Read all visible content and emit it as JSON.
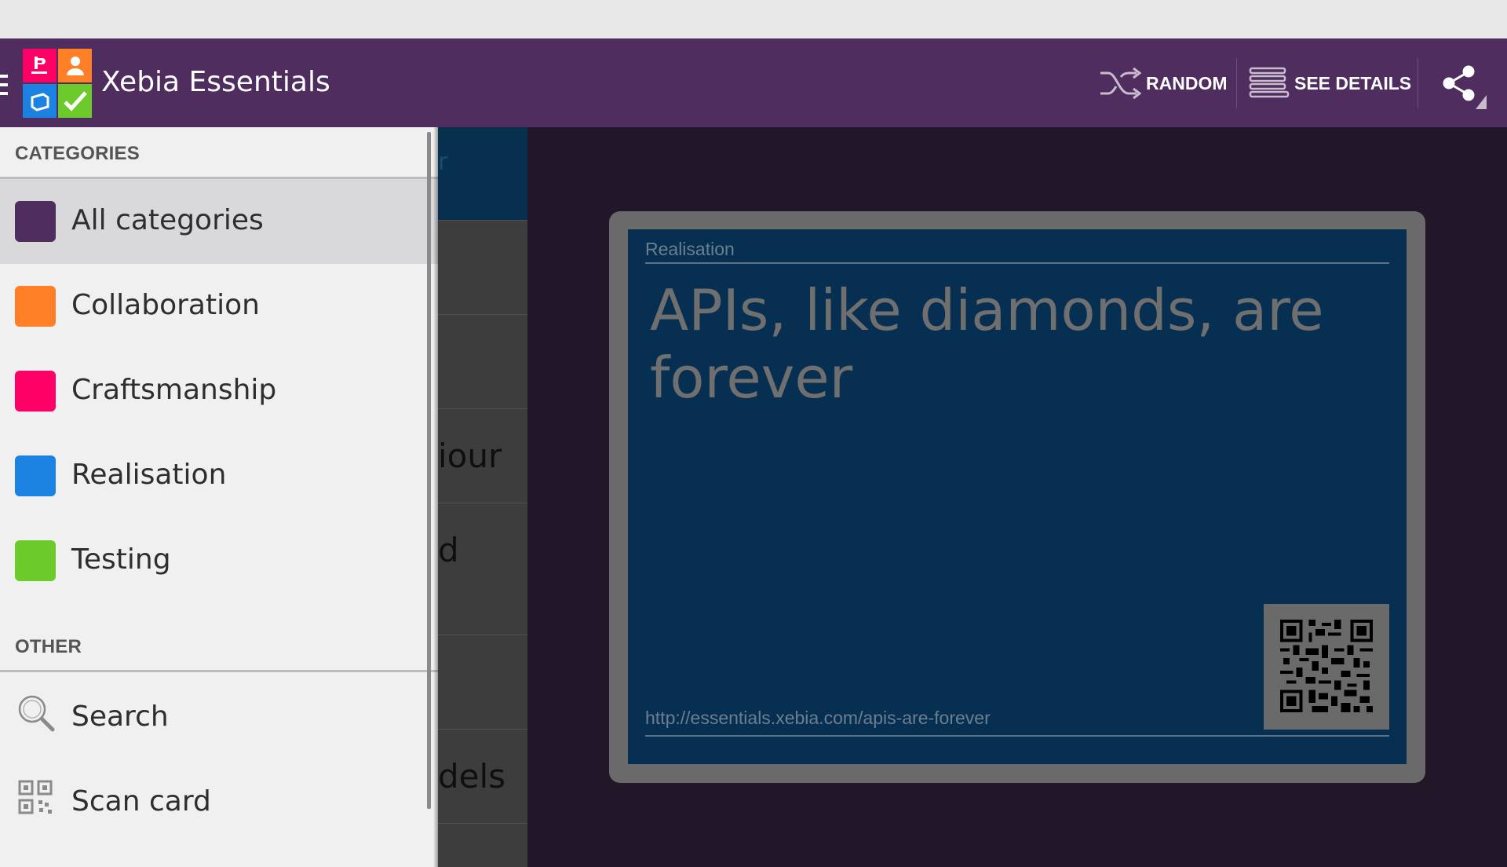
{
  "app": {
    "title": "Xebia Essentials"
  },
  "actionbar": {
    "random_label": "RANDOM",
    "see_details_label": "SEE DETAILS"
  },
  "drawer": {
    "categories_header": "CATEGORIES",
    "items": [
      {
        "label": "All categories",
        "color": "#4f2d5f"
      },
      {
        "label": "Collaboration",
        "color": "#ff7f27"
      },
      {
        "label": "Craftsmanship",
        "color": "#ff0066"
      },
      {
        "label": "Realisation",
        "color": "#1b82e1"
      },
      {
        "label": "Testing",
        "color": "#6ccb2a"
      }
    ],
    "other_header": "OTHER",
    "other_items": [
      {
        "label": "Search",
        "icon": "search-icon"
      },
      {
        "label": "Scan card",
        "icon": "qr-code-icon"
      }
    ]
  },
  "list_fragments": [
    "r",
    "iour",
    "d",
    "dels"
  ],
  "card": {
    "category": "Realisation",
    "title": "APIs, like diamonds, are forever",
    "url": "http://essentials.xebia.com/apis-are-forever",
    "background_color": "#062f52"
  }
}
